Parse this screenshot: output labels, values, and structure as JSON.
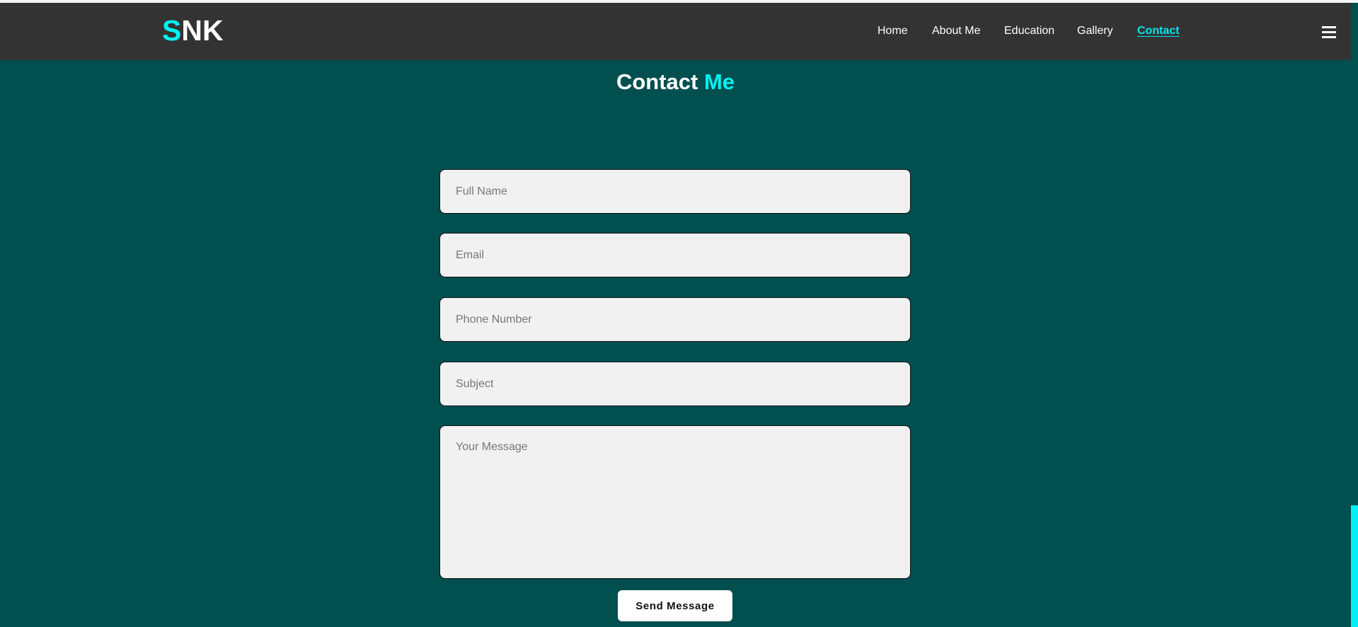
{
  "brand": {
    "logo_first": "S",
    "logo_rest": "NK",
    "accent_color": "#00f2f2",
    "header_color": "#333333",
    "background_color": "#024f50"
  },
  "nav": {
    "items": [
      {
        "label": "Home",
        "active": false
      },
      {
        "label": "About Me",
        "active": false
      },
      {
        "label": "Education",
        "active": false
      },
      {
        "label": "Gallery",
        "active": false
      },
      {
        "label": "Contact",
        "active": true
      }
    ],
    "menu_icon": "hamburger-menu-icon"
  },
  "contact": {
    "title_main": "Contact",
    "title_highlight": "Me",
    "fields": {
      "full_name_placeholder": "Full Name",
      "email_placeholder": "Email",
      "phone_placeholder": "Phone Number",
      "subject_placeholder": "Subject",
      "message_placeholder": "Your Message"
    },
    "values": {
      "full_name": "",
      "email": "",
      "phone": "",
      "subject": "",
      "message": ""
    },
    "send_label": "Send Message"
  }
}
